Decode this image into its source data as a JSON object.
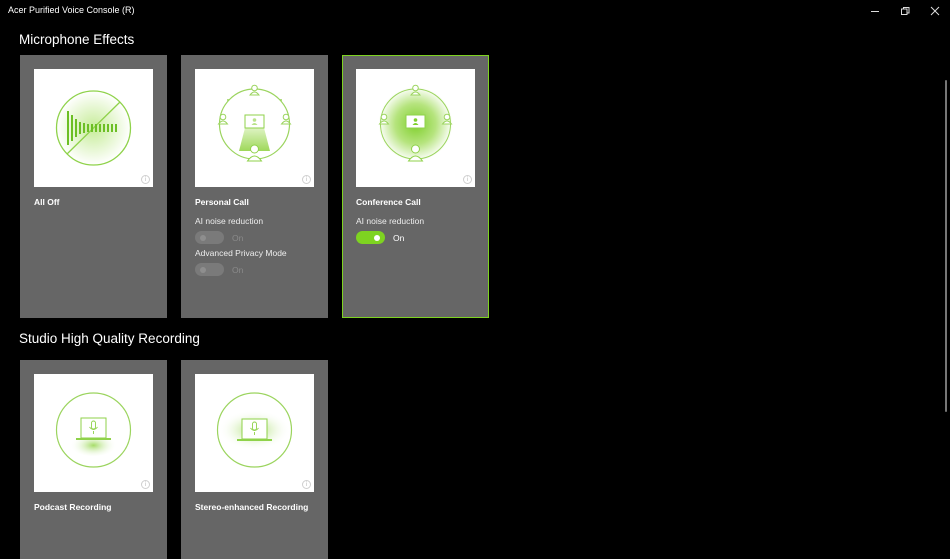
{
  "window": {
    "title": "Acer Purified Voice Console (R)",
    "controls": [
      "minimize-icon",
      "restore-icon",
      "close-icon"
    ]
  },
  "colors": {
    "accent": "#7ed321",
    "card_bg": "#666666",
    "background": "#000000"
  },
  "sections": [
    {
      "title": "Microphone Effects",
      "cards": [
        {
          "label": "All Off",
          "icon": "mic-off-illustration",
          "selected": false,
          "options": []
        },
        {
          "label": "Personal Call",
          "icon": "personal-call-illustration",
          "selected": false,
          "options": [
            {
              "label": "AI noise reduction",
              "state": "On",
              "enabled": false
            },
            {
              "label": "Advanced Privacy Mode",
              "state": "On",
              "enabled": false
            }
          ]
        },
        {
          "label": "Conference Call",
          "icon": "conference-call-illustration",
          "selected": true,
          "options": [
            {
              "label": "AI noise reduction",
              "state": "On",
              "enabled": true
            }
          ]
        }
      ]
    },
    {
      "title": "Studio High Quality Recording",
      "cards": [
        {
          "label": "Podcast Recording",
          "icon": "podcast-recording-illustration",
          "selected": false,
          "options": []
        },
        {
          "label": "Stereo-enhanced Recording",
          "icon": "stereo-recording-illustration",
          "selected": false,
          "options": []
        }
      ]
    }
  ]
}
